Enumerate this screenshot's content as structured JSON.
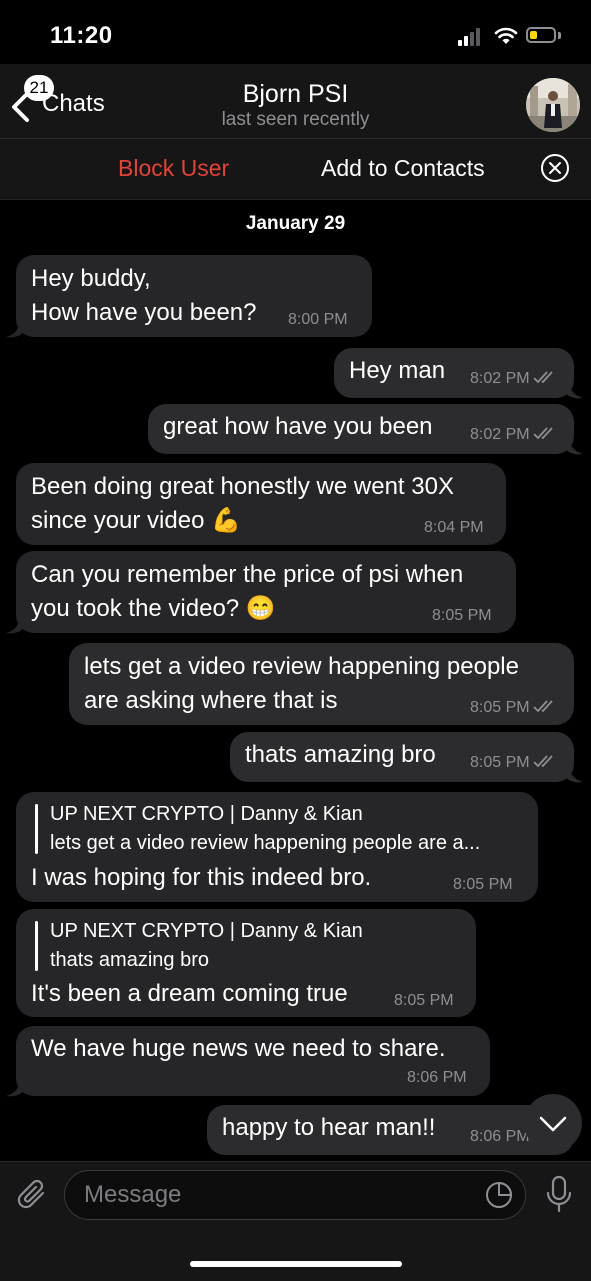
{
  "status": {
    "time": "11:20"
  },
  "header": {
    "back_label": "Chats",
    "unread_count": "21",
    "title": "Bjorn PSI",
    "subtitle": "last seen recently"
  },
  "actions": {
    "block": "Block User",
    "add": "Add to Contacts"
  },
  "date_label": "January 29",
  "messages": [
    {
      "line1": "Hey buddy,",
      "line2": "How have you been?",
      "time": "8:00 PM"
    },
    {
      "text": "Hey man",
      "time": "8:02 PM"
    },
    {
      "text": "great how have you been",
      "time": "8:02 PM"
    },
    {
      "line1": "Been doing great honestly we went 30X",
      "line2": "since your video 💪",
      "time": "8:04 PM"
    },
    {
      "line1": "Can you remember the price of psi when",
      "line2": "you took the video? 😁",
      "time": "8:05 PM"
    },
    {
      "line1": "lets get a video review happening people",
      "line2": "are asking where that is",
      "time": "8:05 PM"
    },
    {
      "text": "thats amazing bro",
      "time": "8:05 PM"
    },
    {
      "reply_name": "UP NEXT CRYPTO | Danny & Kian",
      "reply_text": "lets get a video review happening people are a...",
      "text": "I was hoping for this indeed  bro.",
      "time": "8:05 PM"
    },
    {
      "reply_name": "UP NEXT CRYPTO | Danny & Kian",
      "reply_text": "thats amazing bro",
      "text": "It's been a dream coming true",
      "time": "8:05 PM"
    },
    {
      "text": "We have huge news we need to share.",
      "time": "8:06 PM"
    },
    {
      "text": "happy to hear man!!",
      "time": "8:06 PM"
    }
  ],
  "composer": {
    "placeholder": "Message"
  },
  "colors": {
    "block": "#e0443b",
    "battery": "#ffd60a"
  }
}
